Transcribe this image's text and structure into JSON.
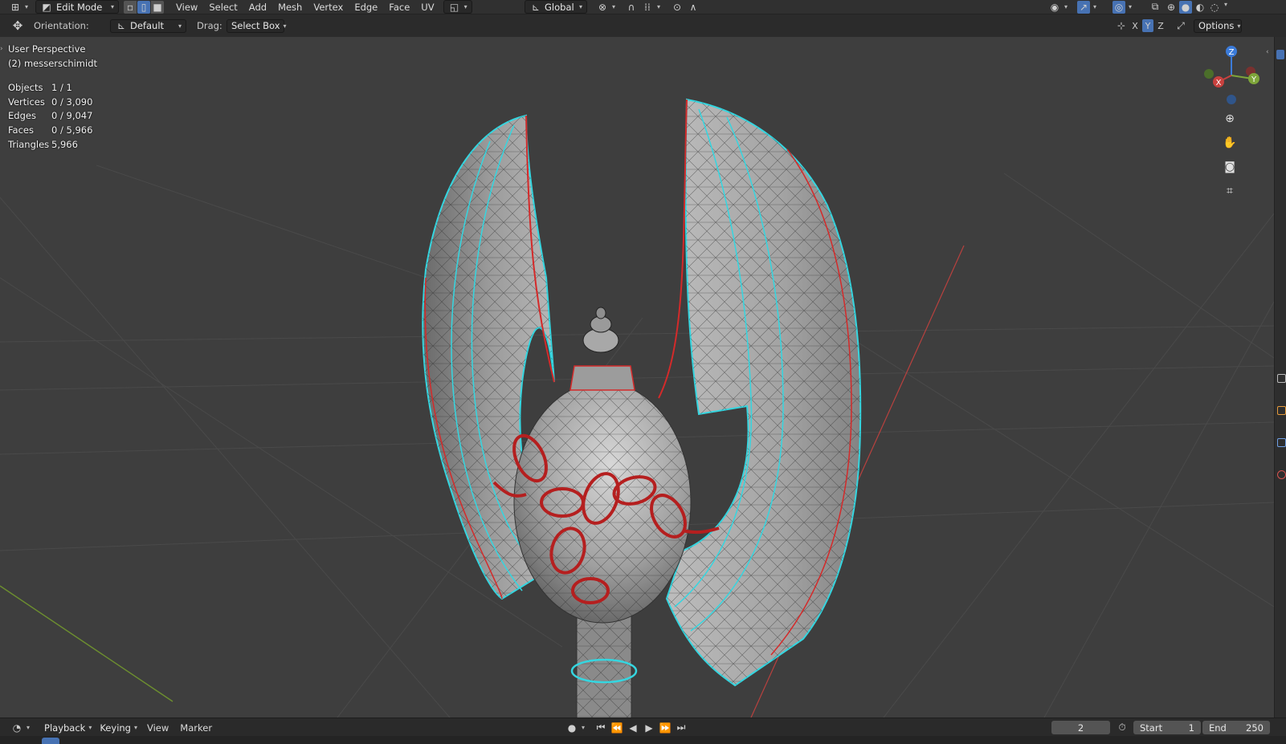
{
  "header": {
    "mode_label": "Edit Mode",
    "menus": [
      "View",
      "Select",
      "Add",
      "Mesh",
      "Vertex",
      "Edge",
      "Face",
      "UV"
    ],
    "transform_orientation": "Global"
  },
  "tool_options": {
    "orientation_label": "Orientation:",
    "orientation_value": "Default",
    "drag_label": "Drag:",
    "drag_value": "Select Box",
    "axes": [
      "X",
      "Y",
      "Z"
    ],
    "options_label": "Options"
  },
  "viewport": {
    "view_name": "User Perspective",
    "object_name": "(2) messerschimidt",
    "stats": [
      {
        "label": "Objects",
        "value": "1 / 1"
      },
      {
        "label": "Vertices",
        "value": "0 / 3,090"
      },
      {
        "label": "Edges",
        "value": "0 / 9,047"
      },
      {
        "label": "Faces",
        "value": "0 / 5,966"
      },
      {
        "label": "Triangles",
        "value": "5,966"
      }
    ],
    "gizmo": {
      "x": "X",
      "y": "Y",
      "z": "Z"
    }
  },
  "timeline": {
    "menus": [
      "Playback",
      "Keying",
      "View",
      "Marker"
    ],
    "current_frame": "2",
    "start_label": "Start",
    "start_value": "1",
    "end_label": "End",
    "end_value": "250"
  },
  "colors": {
    "seam": "#d42a2a",
    "sharp": "#35d6e0",
    "x_axis": "#c8413e",
    "y_axis": "#7ea53a",
    "z_axis": "#3b7bd9"
  }
}
